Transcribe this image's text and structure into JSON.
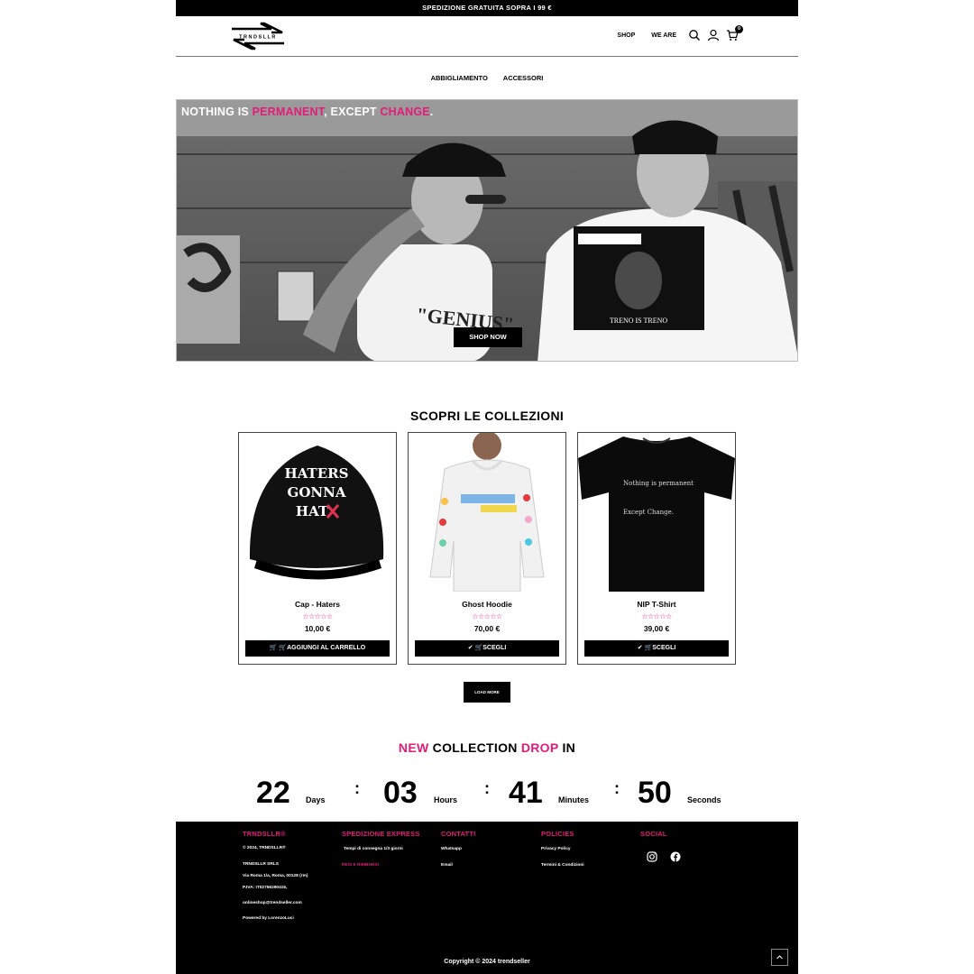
{
  "announcement": "SPEDIZIONE GRATUITA SOPRA I 99 €",
  "brand": "TRNDSLLR",
  "header": {
    "nav": [
      "SHOP",
      "WE ARE"
    ],
    "icons": [
      "search-icon",
      "user-icon",
      "cart-icon"
    ],
    "cart_count": "0"
  },
  "subnav": [
    "ABBIGLIAMENTO",
    "ACCESSORI"
  ],
  "hero": {
    "tagline_parts": [
      "NOTHING IS ",
      "PERMANENT",
      ", EXCEPT ",
      "CHANGE",
      "."
    ],
    "button": "SHOP NOW"
  },
  "collections": {
    "title": "SCOPRI LE COLLEZIONI",
    "rating_stars": "☆☆☆☆☆",
    "products": [
      {
        "name": "Cap - Haters",
        "price": "10,00 €",
        "button": " 🛒AGGIUNGI AL CARRELLO",
        "print": [
          "HATERS",
          "GONNA",
          "HAT"
        ]
      },
      {
        "name": "Ghost Hoodie",
        "price": "70,00 €",
        "button": "🛒SCEGLI"
      },
      {
        "name": "NIP T-Shirt",
        "price": "39,00 €",
        "button": "🛒SCEGLI",
        "print": [
          "Nothing is permanent",
          "Except Change."
        ]
      }
    ],
    "load_more": "LOAD MORE"
  },
  "drop": {
    "title_parts": [
      "NEW",
      " COLLECTION ",
      "DROP",
      " IN"
    ],
    "countdown": [
      {
        "value": "22",
        "label": "Days"
      },
      {
        "value": "03",
        "label": "Hours"
      },
      {
        "value": "41",
        "label": "Minutes"
      },
      {
        "value": "50",
        "label": "Seconds"
      }
    ],
    "separator": ":"
  },
  "footer": {
    "col1": {
      "title": "TRNDSLLR®",
      "lines": [
        "© 2024, TRNDSLLR®",
        "TRNDSLLR SRLS",
        "Via Roma 1/a, Roma, 00128 (rm)",
        "P.IVA: IT02756290415,",
        "onlineshop@trendseller.com",
        "Powered by LorenzoLuci"
      ]
    },
    "col2": {
      "title": "SPEDIZIONE EXPRESS",
      "lines": [
        "Tempi di consegna 1/3 giorni"
      ],
      "pink": "RESI E RIMBORSI"
    },
    "col3": {
      "title": "CONTATTI",
      "lines": [
        "Whatsapp",
        "Email"
      ]
    },
    "col4": {
      "title": "POLICIES",
      "lines": [
        "Privacy Policy",
        "Termini & Condizioni"
      ]
    },
    "col5": {
      "title": "SOCIAL",
      "icons": [
        "instagram-icon",
        "facebook-icon"
      ]
    },
    "copyright": "Copyright © 2024 trendseller"
  },
  "colors": {
    "accent": "#e31c79",
    "black": "#000000",
    "white": "#ffffff"
  }
}
